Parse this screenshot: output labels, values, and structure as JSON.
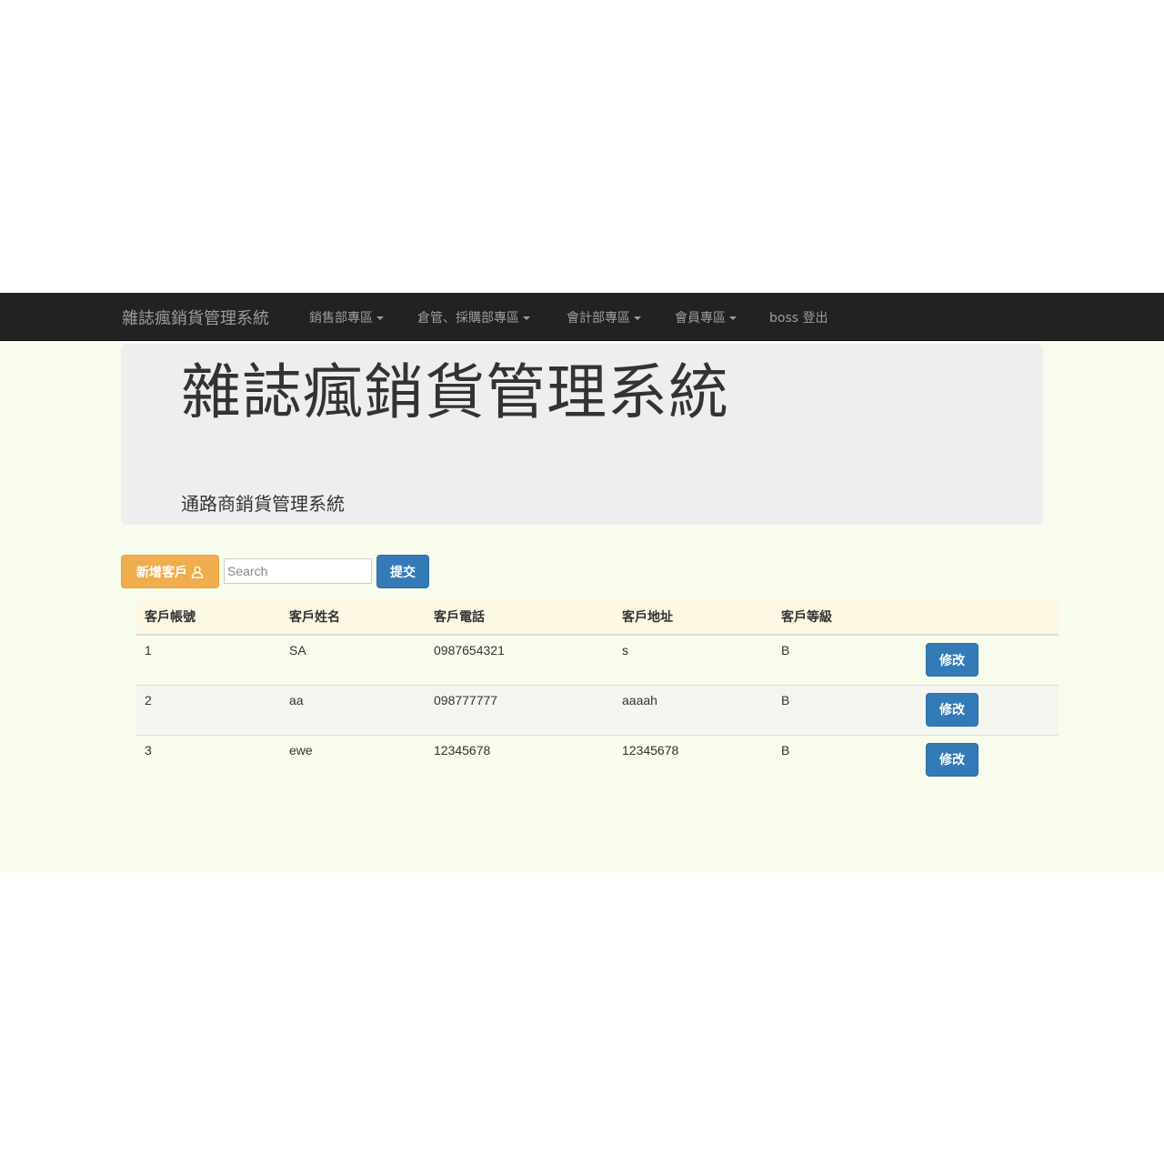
{
  "navbar": {
    "brand": "雜誌瘋銷貨管理系統",
    "items": [
      {
        "label": "銷售部專區",
        "dropdown": true
      },
      {
        "label": "倉管、採購部專區",
        "dropdown": true
      },
      {
        "label": "會計部專區",
        "dropdown": true
      },
      {
        "label": "會員專區",
        "dropdown": true
      },
      {
        "label": "boss 登出",
        "dropdown": false
      }
    ]
  },
  "jumbotron": {
    "title": "雜誌瘋銷貨管理系統",
    "subtitle": "通路商銷貨管理系統"
  },
  "toolbar": {
    "add_label": "新增客戶",
    "add_icon": "user-icon",
    "search_placeholder": "Search",
    "submit_label": "提交"
  },
  "table": {
    "headers": [
      "客戶帳號",
      "客戶姓名",
      "客戶電話",
      "客戶地址",
      "客戶等級"
    ],
    "edit_label": "修改",
    "rows": [
      {
        "id": "1",
        "name": "SA",
        "phone": "0987654321",
        "address": "s",
        "level": "B"
      },
      {
        "id": "2",
        "name": "aa",
        "phone": "098777777",
        "address": "aaaah",
        "level": "B"
      },
      {
        "id": "3",
        "name": "ewe",
        "phone": "12345678",
        "address": "12345678",
        "level": "B"
      }
    ]
  },
  "colors": {
    "navbar_bg": "#222222",
    "page_bg": "#f8fcec",
    "warning": "#f0ad4e",
    "primary": "#337ab7"
  }
}
